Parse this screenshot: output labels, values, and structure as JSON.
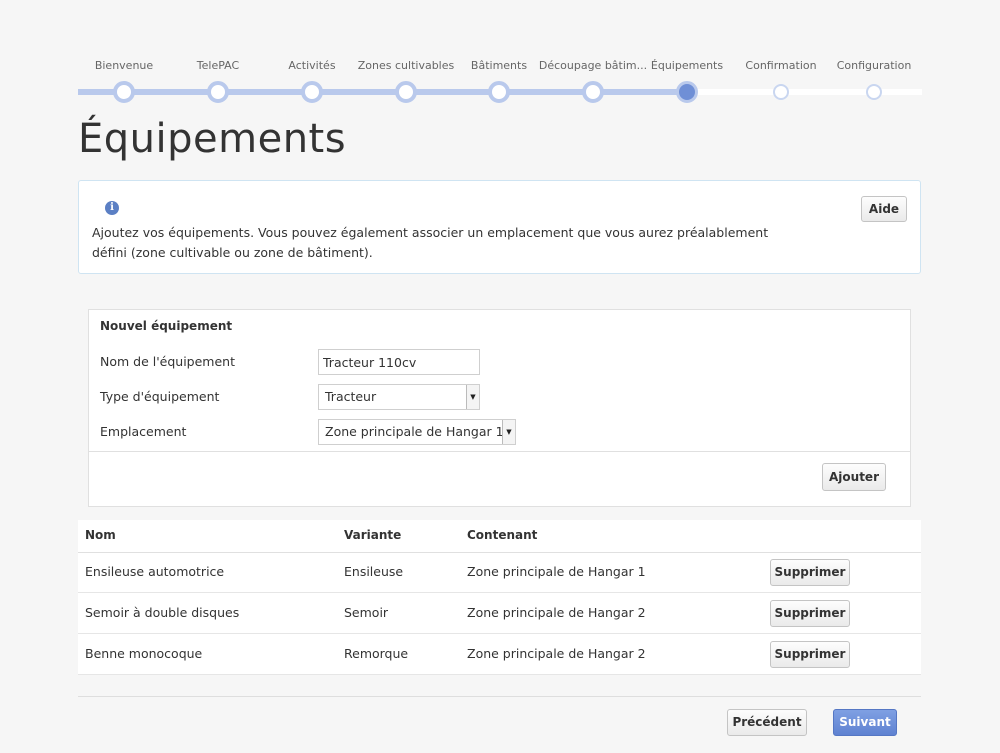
{
  "stepper": {
    "steps": [
      {
        "label": "Bienvenue",
        "state": "done"
      },
      {
        "label": "TelePAC",
        "state": "done"
      },
      {
        "label": "Activités",
        "state": "done"
      },
      {
        "label": "Zones cultivables",
        "state": "done"
      },
      {
        "label": "Bâtiments",
        "state": "done"
      },
      {
        "label": "Découpage bâtim...",
        "state": "done"
      },
      {
        "label": "Équipements",
        "state": "current"
      },
      {
        "label": "Confirmation",
        "state": "todo"
      },
      {
        "label": "Configuration",
        "state": "todo"
      }
    ]
  },
  "page": {
    "title": "Équipements"
  },
  "info": {
    "icon": "info-icon",
    "text": "Ajoutez vos équipements. Vous pouvez également associer un emplacement que vous aurez préalablement défini (zone cultivable ou zone de bâtiment).",
    "help_label": "Aide"
  },
  "form": {
    "title": "Nouvel équipement",
    "name_label": "Nom de l'équipement",
    "name_value": "Tracteur 110cv",
    "type_label": "Type d'équipement",
    "type_value": "Tracteur",
    "location_label": "Emplacement",
    "location_value": "Zone principale de Hangar 1",
    "add_label": "Ajouter"
  },
  "table": {
    "headers": {
      "name": "Nom",
      "variant": "Variante",
      "container": "Contenant"
    },
    "rows": [
      {
        "name": "Ensileuse automotrice",
        "variant": "Ensileuse",
        "container": "Zone principale de Hangar 1",
        "action": "Supprimer"
      },
      {
        "name": "Semoir à double disques",
        "variant": "Semoir",
        "container": "Zone principale de Hangar 2",
        "action": "Supprimer"
      },
      {
        "name": "Benne monocoque",
        "variant": "Remorque",
        "container": "Zone principale de Hangar 2",
        "action": "Supprimer"
      }
    ]
  },
  "footer": {
    "prev_label": "Précédent",
    "next_label": "Suivant"
  },
  "colors": {
    "accent": "#6f8fd6",
    "track_done": "#b9c9ec",
    "info_border": "#cfe4f2"
  }
}
